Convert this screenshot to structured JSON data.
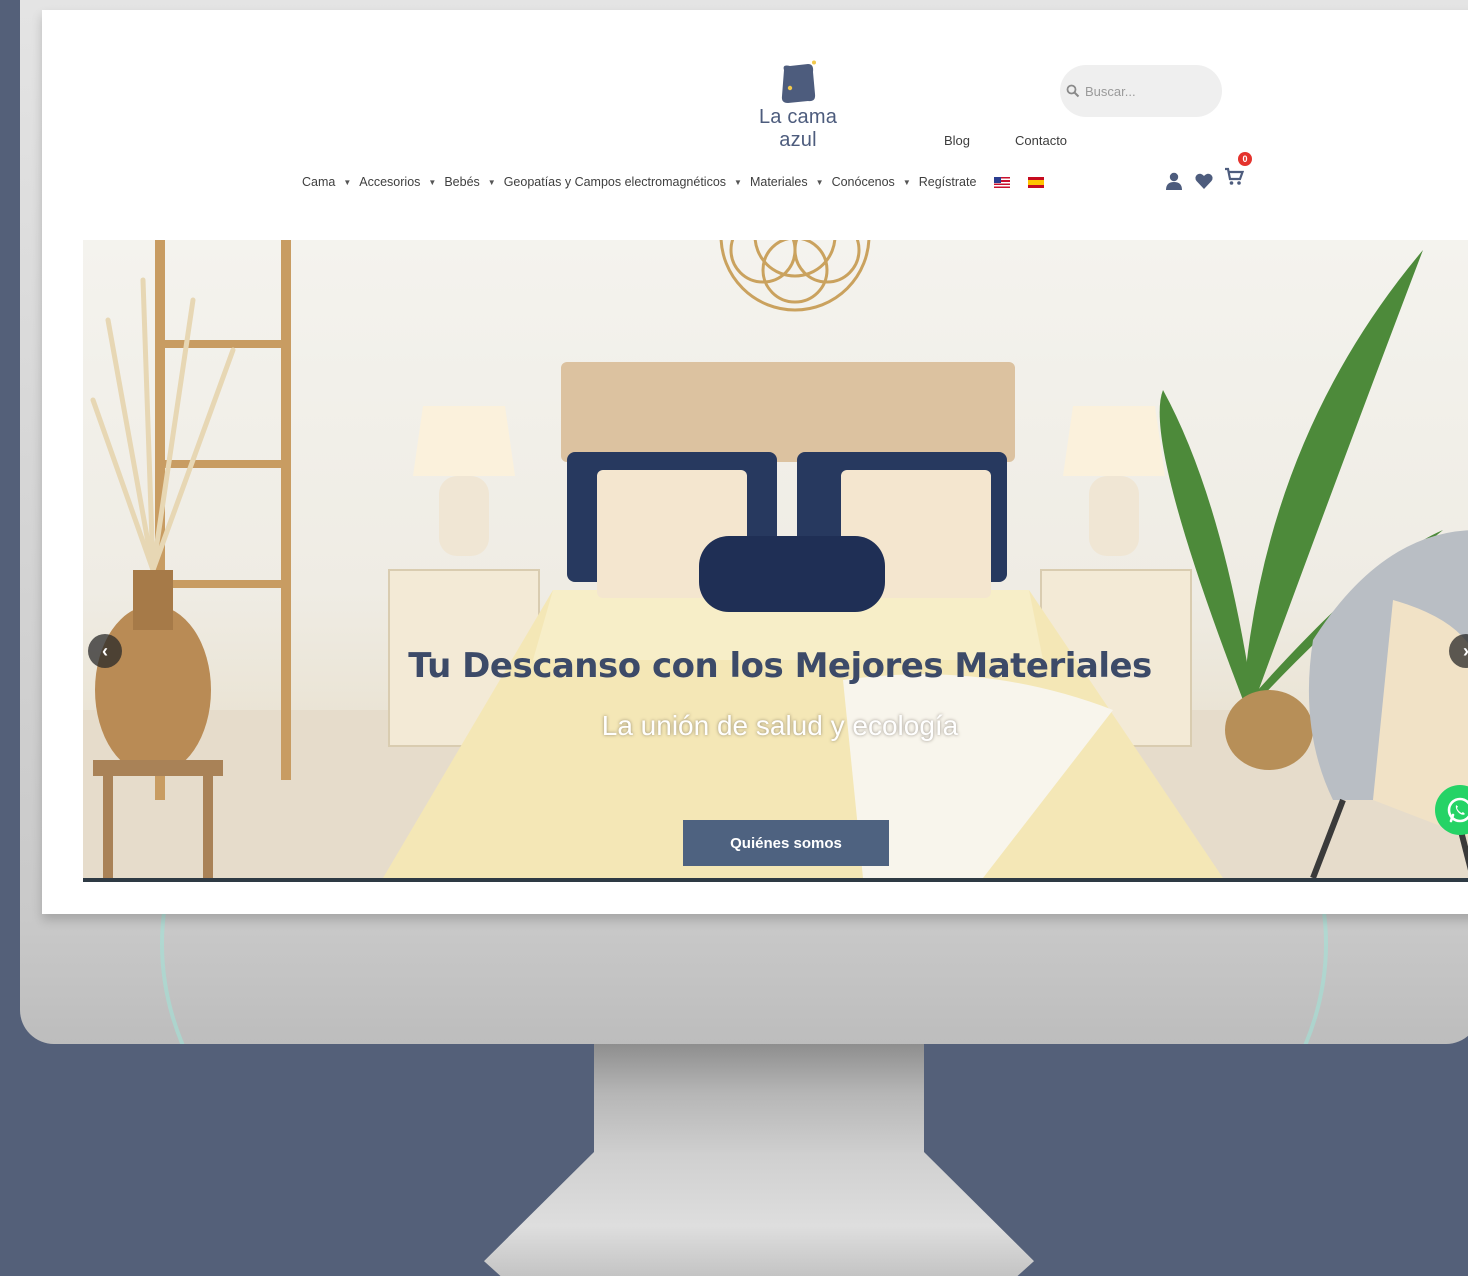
{
  "brand": {
    "name": "La cama azul"
  },
  "search": {
    "placeholder": "Buscar..."
  },
  "top_links": {
    "blog": "Blog",
    "contact": "Contacto"
  },
  "nav": {
    "items": [
      {
        "label": "Cama",
        "has_dropdown": true
      },
      {
        "label": "Accesorios",
        "has_dropdown": true
      },
      {
        "label": "Bebés",
        "has_dropdown": true
      },
      {
        "label": "Geopatías y Campos electromagnéticos",
        "has_dropdown": true
      },
      {
        "label": "Materiales",
        "has_dropdown": true
      },
      {
        "label": "Conócenos",
        "has_dropdown": true
      },
      {
        "label": "Regístrate",
        "has_dropdown": false
      }
    ],
    "languages": [
      "us-flag-icon",
      "es-flag-icon"
    ]
  },
  "header_icons": {
    "user": "user-icon",
    "wishlist": "heart-icon",
    "cart": "cart-icon",
    "cart_count": "0"
  },
  "hero": {
    "title": "Tu Descanso con los Mejores Materiales",
    "subtitle": "La unión de salud y ecología",
    "button_label": "Quiénes somos"
  },
  "colors": {
    "brand_blue": "#4d5c7d",
    "button": "#4e6280",
    "cart_badge": "#e4332d",
    "whatsapp": "#25d366",
    "backdrop": "#546079"
  }
}
